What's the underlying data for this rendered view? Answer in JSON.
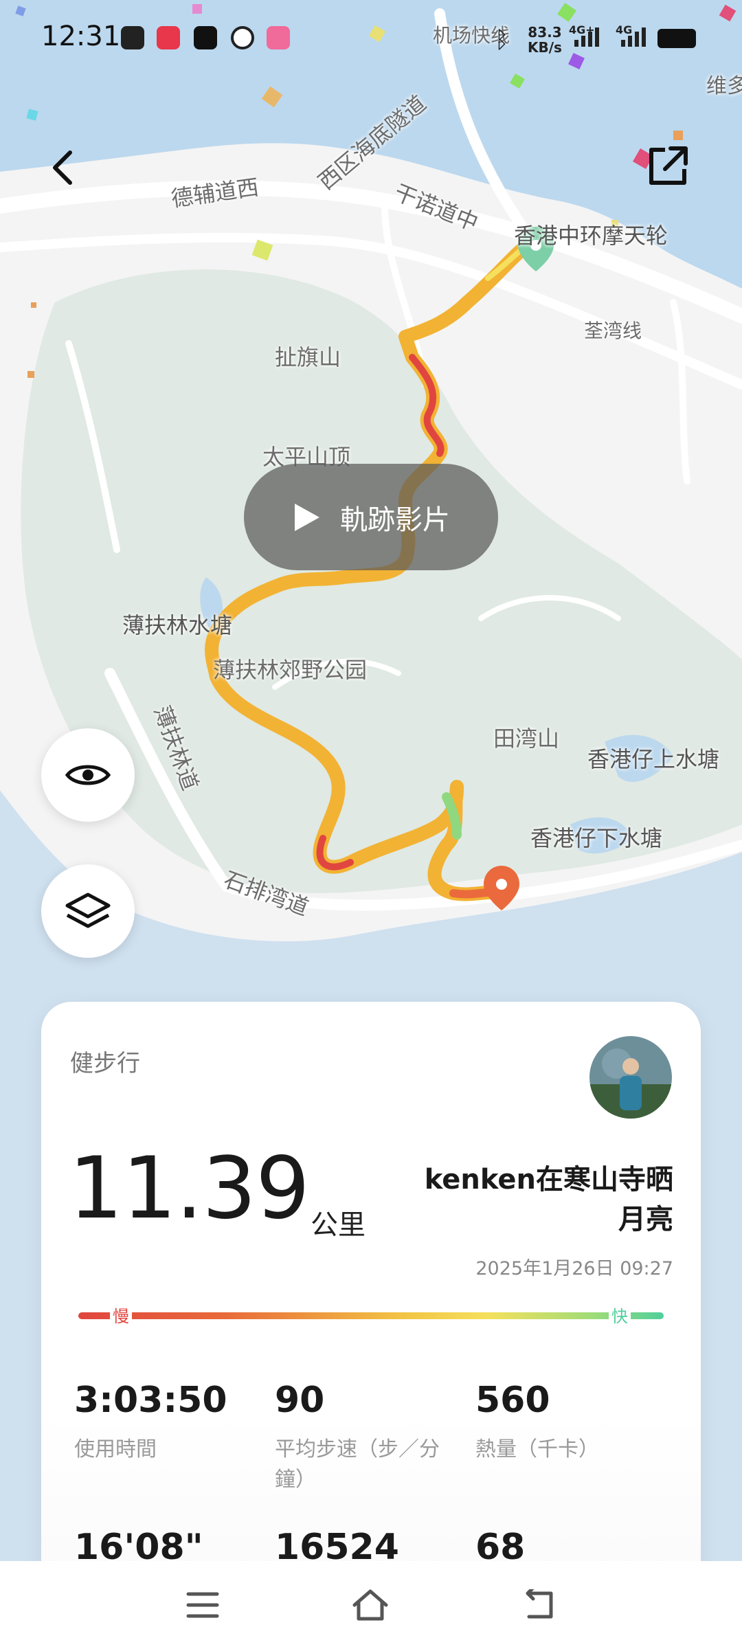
{
  "status_bar": {
    "time": "12:31",
    "net_speed_value": "83.3",
    "net_speed_unit": "KB/s",
    "network_1": "4G+",
    "network_2": "4G"
  },
  "map": {
    "labels": {
      "west_harbour_tunnel": "西区海底隧道",
      "des_voeux_road_west": "德辅道西",
      "connaught_road": "干诺道中",
      "ferris_wheel": "香港中环摩天轮",
      "tsuen_wan_line": "荃湾线",
      "airport_express": "机场快线",
      "high_west": "扯旗山",
      "victoria_peak": "太平山顶",
      "pok_fu_lam_reservoir": "薄扶林水塘",
      "pok_fu_lam_country_park": "薄扶林郊野公园",
      "pok_fu_lam_road": "薄扶林道",
      "tin_wan_shan": "田湾山",
      "aberdeen_upper_reservoir": "香港仔上水塘",
      "aberdeen_lower_reservoir": "香港仔下水塘",
      "shek_pai_wan_road": "石排湾道",
      "victoria_street_partial": "维多"
    },
    "track_video_label": "軌跡影片",
    "colors": {
      "water": "#bcd8ee",
      "land": "#f3f3f3",
      "park": "#dfe8e2",
      "route_slow": "#e0463f",
      "route_mid": "#f2b233",
      "route_fast": "#8fd880",
      "start_pin": "#7ccfa6",
      "end_pin": "#ea6a3d"
    }
  },
  "card": {
    "activity_type": "健步行",
    "distance": "11.39",
    "distance_unit": "公里",
    "title": "kenken在寒山寺晒月亮",
    "date": "2025年1月26日 09:27",
    "speed_slow": "慢",
    "speed_fast": "快",
    "stats": [
      {
        "value": "3:03:50",
        "label": "使用時間"
      },
      {
        "value": "90",
        "label": "平均步速（步／分鐘）"
      },
      {
        "value": "560",
        "label": "熱量（千卡）"
      },
      {
        "value": "16'08\"",
        "label": ""
      },
      {
        "value": "16524",
        "label": ""
      },
      {
        "value": "68",
        "label": ""
      }
    ]
  },
  "icons": {
    "back": "chevron-left-icon",
    "share": "external-link-icon",
    "play": "play-icon",
    "eye": "eye-icon",
    "layers": "layers-icon",
    "menu": "menu-icon",
    "home": "home-icon",
    "return": "back-arrow-icon"
  }
}
